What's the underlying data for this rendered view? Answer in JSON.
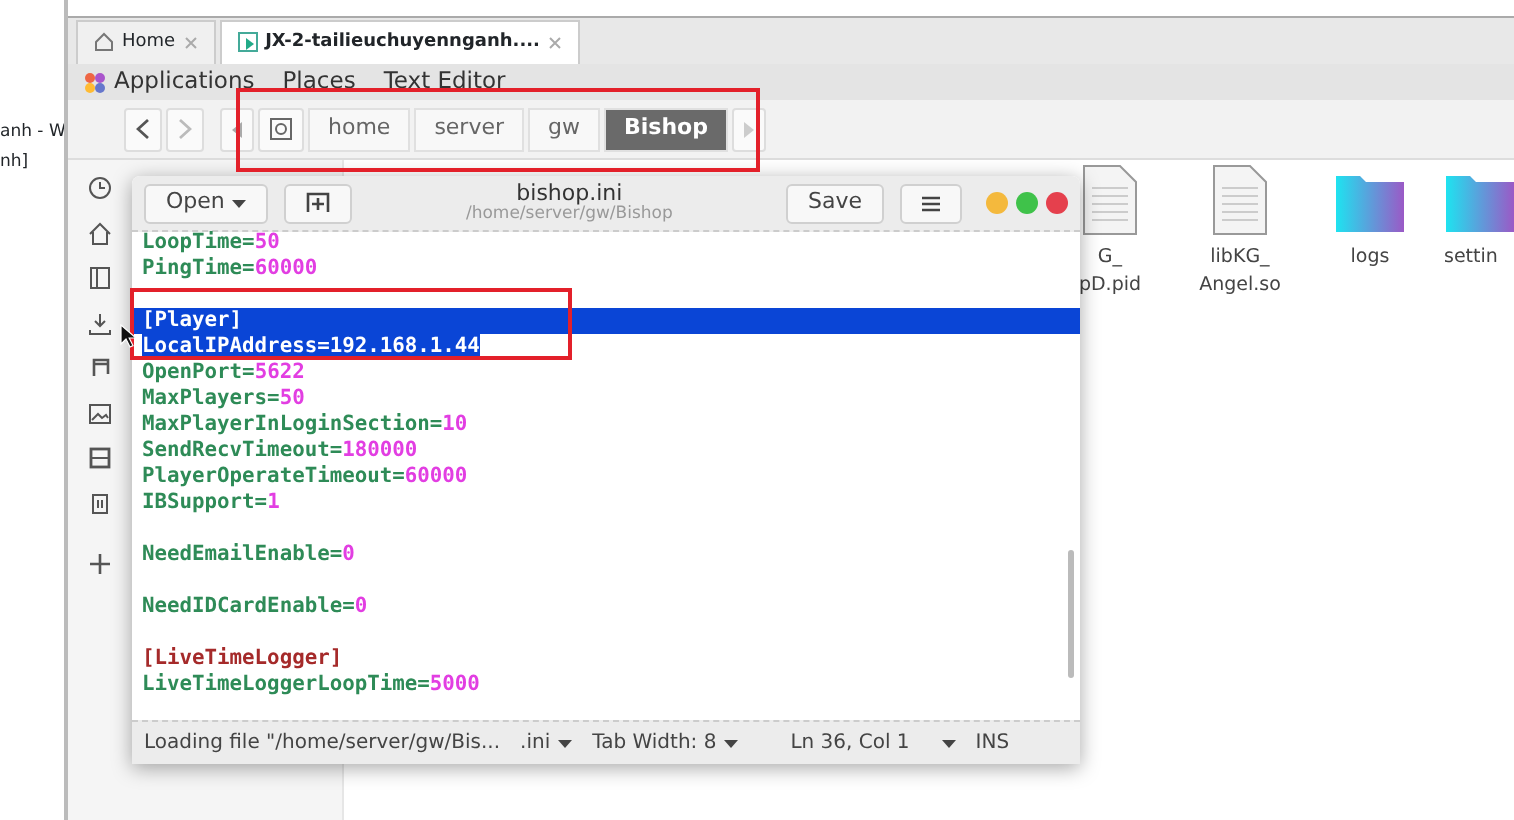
{
  "vm_panel": {
    "texts": [
      "anh - W",
      "nh]"
    ]
  },
  "vm_tabs": [
    {
      "label": "Home",
      "selected": false
    },
    {
      "label": "JX-2-tailieuchuyennganh....",
      "selected": true
    }
  ],
  "top_bar": {
    "menus": [
      "Applications",
      "Places",
      "Text Editor"
    ]
  },
  "file_manager": {
    "path": [
      {
        "label": "home",
        "selected": false
      },
      {
        "label": "server",
        "selected": false
      },
      {
        "label": "gw",
        "selected": false
      },
      {
        "label": "Bishop",
        "selected": true
      }
    ],
    "sidebar": [
      {
        "kind": "clock"
      },
      {
        "kind": "home"
      },
      {
        "kind": "doc"
      },
      {
        "kind": "download"
      },
      {
        "kind": "music"
      },
      {
        "kind": "picture"
      },
      {
        "kind": "video"
      },
      {
        "kind": "trash"
      },
      {
        "kind": "plus"
      }
    ],
    "files": [
      {
        "kind": "file",
        "lines": [
          "G_",
          "pD.pid"
        ]
      },
      {
        "kind": "file",
        "lines": [
          "libKG_",
          "Angel.so"
        ]
      },
      {
        "kind": "folder",
        "lines": [
          "logs"
        ]
      },
      {
        "kind": "folder",
        "lines": [
          "settin"
        ]
      }
    ]
  },
  "editor": {
    "open_button": "Open",
    "title": "bishop.ini",
    "subtitle": "/home/server/gw/Bishop",
    "save_button": "Save",
    "lines": [
      {
        "kind": "pair",
        "key": "LoopTime=",
        "value": "50",
        "selected": false
      },
      {
        "kind": "pair",
        "key": "PingTime=",
        "value": "60000",
        "selected": false
      },
      {
        "kind": "blank",
        "selected": false
      },
      {
        "kind": "section",
        "text": "[Player]",
        "selected": true
      },
      {
        "kind": "pair",
        "key": "LocalIPAddress=",
        "value": "192.168.1.44",
        "selected": true
      },
      {
        "kind": "pair",
        "key": "OpenPort=",
        "value": "5622",
        "selected": false
      },
      {
        "kind": "pair",
        "key": "MaxPlayers=",
        "value": "50",
        "selected": false
      },
      {
        "kind": "pair",
        "key": "MaxPlayerInLoginSection=",
        "value": "10",
        "selected": false
      },
      {
        "kind": "pair",
        "key": "SendRecvTimeout=",
        "value": "180000",
        "selected": false
      },
      {
        "kind": "pair",
        "key": "PlayerOperateTimeout=",
        "value": "60000",
        "selected": false
      },
      {
        "kind": "pair",
        "key": "IBSupport=",
        "value": "1",
        "selected": false
      },
      {
        "kind": "blank",
        "selected": false
      },
      {
        "kind": "pair",
        "key": "NeedEmailEnable=",
        "value": "0",
        "selected": false
      },
      {
        "kind": "blank",
        "selected": false
      },
      {
        "kind": "pair",
        "key": "NeedIDCardEnable=",
        "value": "0",
        "selected": false
      },
      {
        "kind": "blank",
        "selected": false
      },
      {
        "kind": "section",
        "text": "[LiveTimeLogger]",
        "selected": false
      },
      {
        "kind": "pair",
        "key": "LiveTimeLoggerLoopTime=",
        "value": "5000",
        "selected": false
      }
    ],
    "status": {
      "message": "Loading file \"/home/server/gw/Bis...",
      "language": ".ini",
      "tab_width": "Tab Width: 8",
      "position": "Ln 36, Col 1",
      "mode": "INS"
    }
  }
}
